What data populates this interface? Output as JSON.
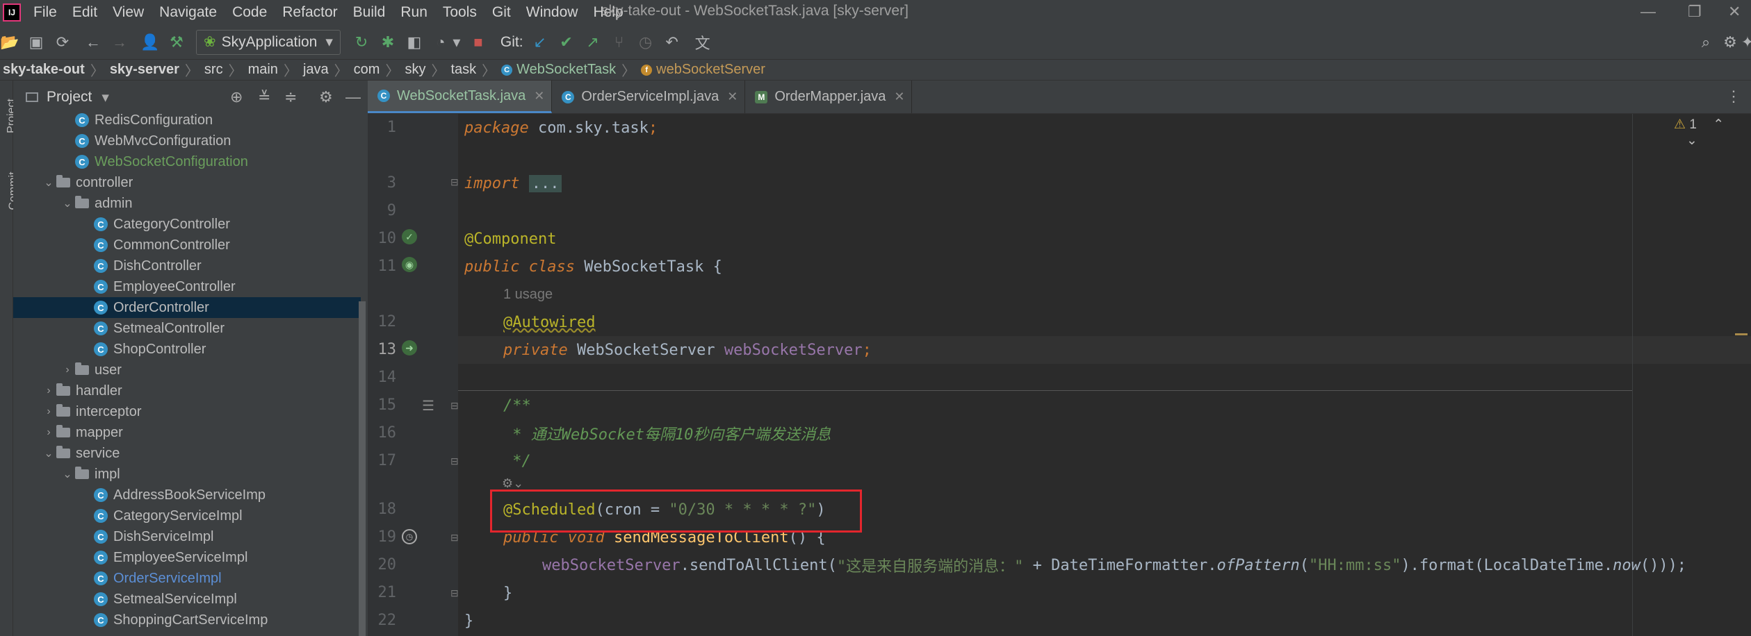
{
  "window": {
    "title": "sky-take-out - WebSocketTask.java [sky-server]",
    "logo": "IJ"
  },
  "menu": [
    "File",
    "Edit",
    "View",
    "Navigate",
    "Code",
    "Refactor",
    "Build",
    "Run",
    "Tools",
    "Git",
    "Window",
    "Help"
  ],
  "toolbar": {
    "run_config": "SkyApplication",
    "git_label": "Git:"
  },
  "breadcrumb": [
    "sky-take-out",
    "sky-server",
    "src",
    "main",
    "java",
    "com",
    "sky",
    "task",
    "WebSocketTask",
    "webSocketServer"
  ],
  "project_panel": {
    "title": "Project",
    "side_tabs": [
      "Project",
      "Commit"
    ],
    "tree": [
      {
        "label": "RedisConfiguration",
        "indent": 2,
        "type": "class",
        "color": "#bbbbbb"
      },
      {
        "label": "WebMvcConfiguration",
        "indent": 2,
        "type": "class",
        "color": "#bbbbbb"
      },
      {
        "label": "WebSocketConfiguration",
        "indent": 2,
        "type": "class",
        "color": "#6a9e5c"
      },
      {
        "label": "controller",
        "indent": 1,
        "type": "folder",
        "open": true
      },
      {
        "label": "admin",
        "indent": 2,
        "type": "folder",
        "open": true
      },
      {
        "label": "CategoryController",
        "indent": 3,
        "type": "class"
      },
      {
        "label": "CommonController",
        "indent": 3,
        "type": "class"
      },
      {
        "label": "DishController",
        "indent": 3,
        "type": "class"
      },
      {
        "label": "EmployeeController",
        "indent": 3,
        "type": "class"
      },
      {
        "label": "OrderController",
        "indent": 3,
        "type": "class",
        "selected": true
      },
      {
        "label": "SetmealController",
        "indent": 3,
        "type": "class"
      },
      {
        "label": "ShopController",
        "indent": 3,
        "type": "class"
      },
      {
        "label": "user",
        "indent": 2,
        "type": "folder",
        "open": false
      },
      {
        "label": "handler",
        "indent": 1,
        "type": "folder",
        "open": false
      },
      {
        "label": "interceptor",
        "indent": 1,
        "type": "folder",
        "open": false
      },
      {
        "label": "mapper",
        "indent": 1,
        "type": "folder",
        "open": false
      },
      {
        "label": "service",
        "indent": 1,
        "type": "folder",
        "open": true
      },
      {
        "label": "impl",
        "indent": 2,
        "type": "folder",
        "open": true
      },
      {
        "label": "AddressBookServiceImp",
        "indent": 3,
        "type": "class"
      },
      {
        "label": "CategoryServiceImpl",
        "indent": 3,
        "type": "class"
      },
      {
        "label": "DishServiceImpl",
        "indent": 3,
        "type": "class"
      },
      {
        "label": "EmployeeServiceImpl",
        "indent": 3,
        "type": "class"
      },
      {
        "label": "OrderServiceImpl",
        "indent": 3,
        "type": "class",
        "color": "#5c8fd6"
      },
      {
        "label": "SetmealServiceImpl",
        "indent": 3,
        "type": "class"
      },
      {
        "label": "ShoppingCartServiceImp",
        "indent": 3,
        "type": "class"
      }
    ]
  },
  "tabs": [
    {
      "label": "WebSocketTask.java",
      "active": true
    },
    {
      "label": "OrderServiceImpl.java",
      "active": false
    },
    {
      "label": "OrderMapper.java",
      "active": false
    }
  ],
  "editor": {
    "warning_count": "1",
    "usage_hint": "1 usage",
    "line_numbers": [
      "1",
      "3",
      "9",
      "10",
      "11",
      "12",
      "13",
      "14",
      "15",
      "16",
      "17",
      "18",
      "19",
      "20",
      "21",
      "22"
    ]
  },
  "code": {
    "l1_kw": "package",
    "l1_rest": " com.sky.task",
    "l1_semi": ";",
    "l3_kw": "import",
    "l3_dots": "...",
    "l10": "@Component",
    "l11_kw1": "public",
    "l11_kw2": "class",
    "l11_rest": " WebSocketTask {",
    "l12": "@Autowired",
    "l13_kw": "private",
    "l13_type": " WebSocketServer ",
    "l13_field": "webSocketServer",
    "l13_semi": ";",
    "l15": "/**",
    "l16": " * 通过WebSocket每隔10秒向客户端发送消息",
    "l17": " */",
    "l18_ann": "@Scheduled",
    "l18_open": "(cron = ",
    "l18_str": "\"0/30 * * * * ?\"",
    "l18_close": ")",
    "l19_kw1": "public",
    "l19_kw2": "void",
    "l19_fn": "sendMessageToClient",
    "l19_rest": "() {",
    "l20_field": "webSocketServer",
    "l20_call": ".sendToAllClient(",
    "l20_str1": "\"这是来自服务端的消息：\"",
    "l20_mid": " + DateTimeFormatter.",
    "l20_ofp": "ofPattern",
    "l20_paren": "(",
    "l20_str2": "\"HH:mm:ss\"",
    "l20_fmt": ").format(LocalDateTime.",
    "l20_now": "now",
    "l20_end": "()));",
    "l21": "}",
    "l22": "}"
  }
}
